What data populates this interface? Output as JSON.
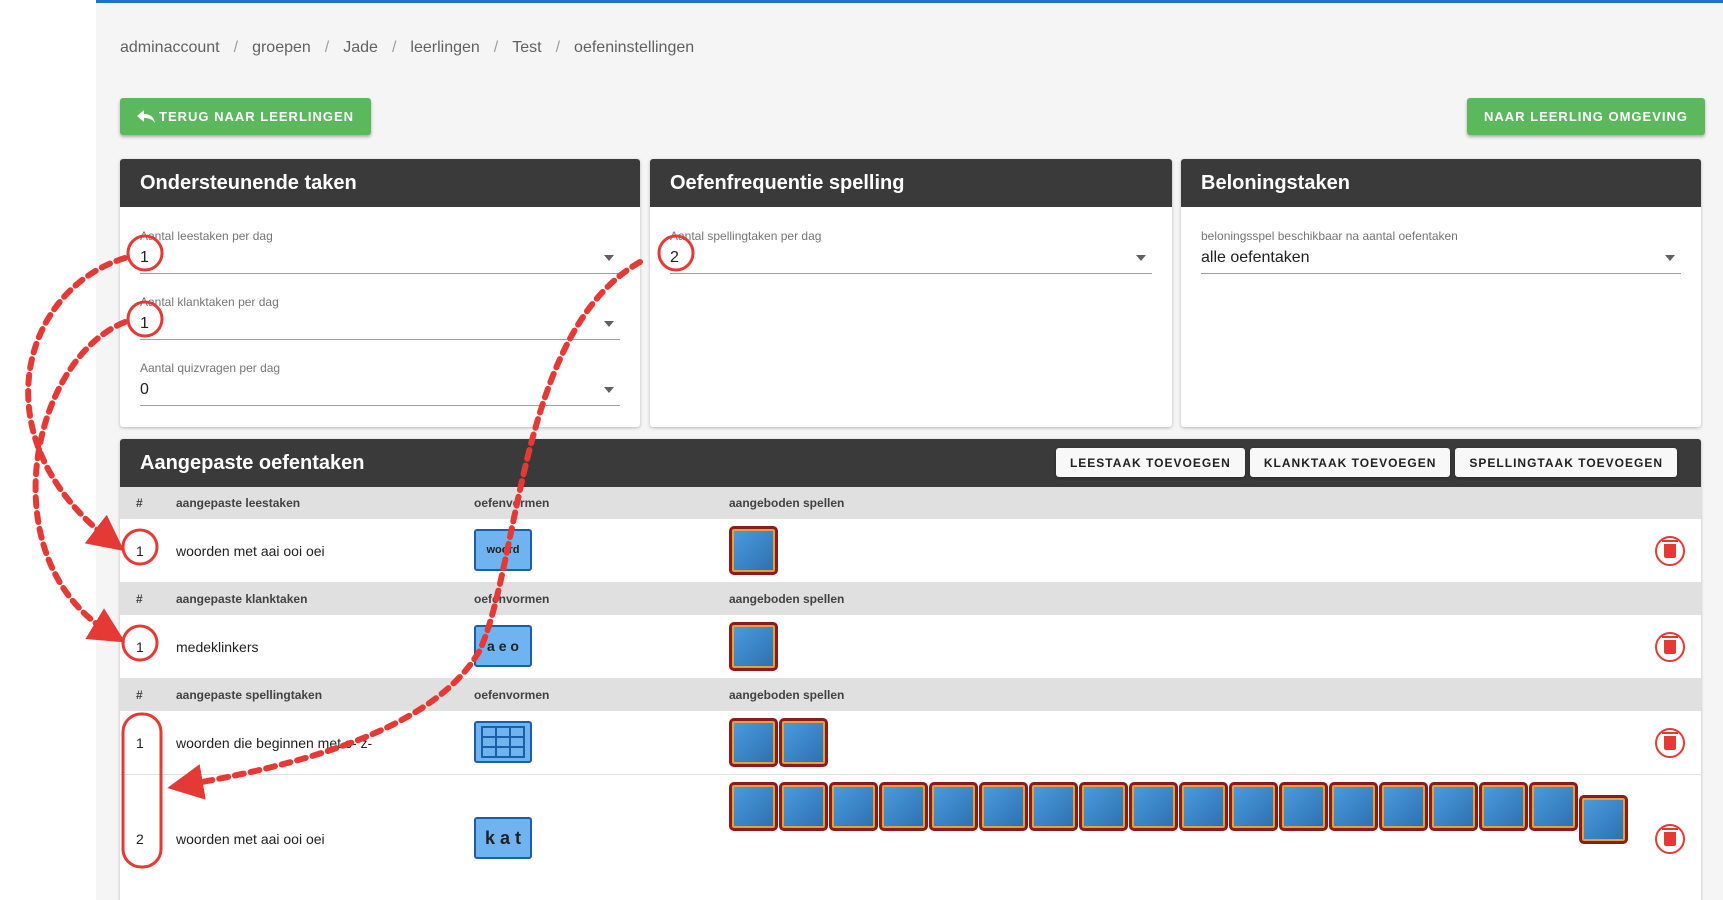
{
  "breadcrumb": [
    "adminaccount",
    "groepen",
    "Jade",
    "leerlingen",
    "Test",
    "oefeninstellingen"
  ],
  "breadcrumb_separator": "/",
  "buttons": {
    "back_label": "TERUG NAAR LEERLINGEN",
    "student_env_label": "NAAR LEERLING OMGEVING",
    "add_reading_label": "LEESTAAK TOEVOEGEN",
    "add_sound_label": "KLANKTAAK TOEVOEGEN",
    "add_spelling_label": "SPELLINGTAAK TOEVOEGEN"
  },
  "support_card": {
    "title": "Ondersteunende taken",
    "fields": [
      {
        "label": "Aantal leestaken per dag",
        "value": "1"
      },
      {
        "label": "Aantal klanktaken per dag",
        "value": "1"
      },
      {
        "label": "Aantal quizvragen per dag",
        "value": "0"
      }
    ]
  },
  "spelling_card": {
    "title": "Oefenfrequentie spelling",
    "fields": [
      {
        "label": "Aantal spellingtaken per dag",
        "value": "2"
      }
    ]
  },
  "reward_card": {
    "title": "Beloningstaken",
    "fields": [
      {
        "label": "beloningsspel beschikbaar na aantal oefentaken",
        "value": "alle oefentaken"
      }
    ]
  },
  "custom": {
    "title": "Aangepaste oefentaken",
    "sections": [
      {
        "headers": {
          "num": "#",
          "name": "aangepaste leestaken",
          "forms": "oefenvormen",
          "games": "aangeboden spellen"
        },
        "rows": [
          {
            "num": "1",
            "name": "woorden met aai ooi oei",
            "form_icon": "woord",
            "games": 1
          }
        ]
      },
      {
        "headers": {
          "num": "#",
          "name": "aangepaste klanktaken",
          "forms": "oefenvormen",
          "games": "aangeboden spellen"
        },
        "rows": [
          {
            "num": "1",
            "name": "medeklinkers",
            "form_icon": "aeo",
            "games": 1
          }
        ]
      },
      {
        "headers": {
          "num": "#",
          "name": "aangepaste spellingtaken",
          "forms": "oefenvormen",
          "games": "aangeboden spellen"
        },
        "rows": [
          {
            "num": "1",
            "name": "woorden die beginnen met s- z-",
            "form_icon": "grid",
            "games": 2
          },
          {
            "num": "2",
            "name": "woorden met aai ooi oei",
            "form_icon": "kat",
            "games": 18
          }
        ]
      }
    ]
  },
  "form_icon_texts": {
    "woord": "woord",
    "aeo": "a e o",
    "kat": "k a t"
  },
  "colors": {
    "accent_blue": "#1e6fd0",
    "green": "#5cb85c",
    "header_dark": "#3a3a3a",
    "annotation_red": "#e53935"
  }
}
